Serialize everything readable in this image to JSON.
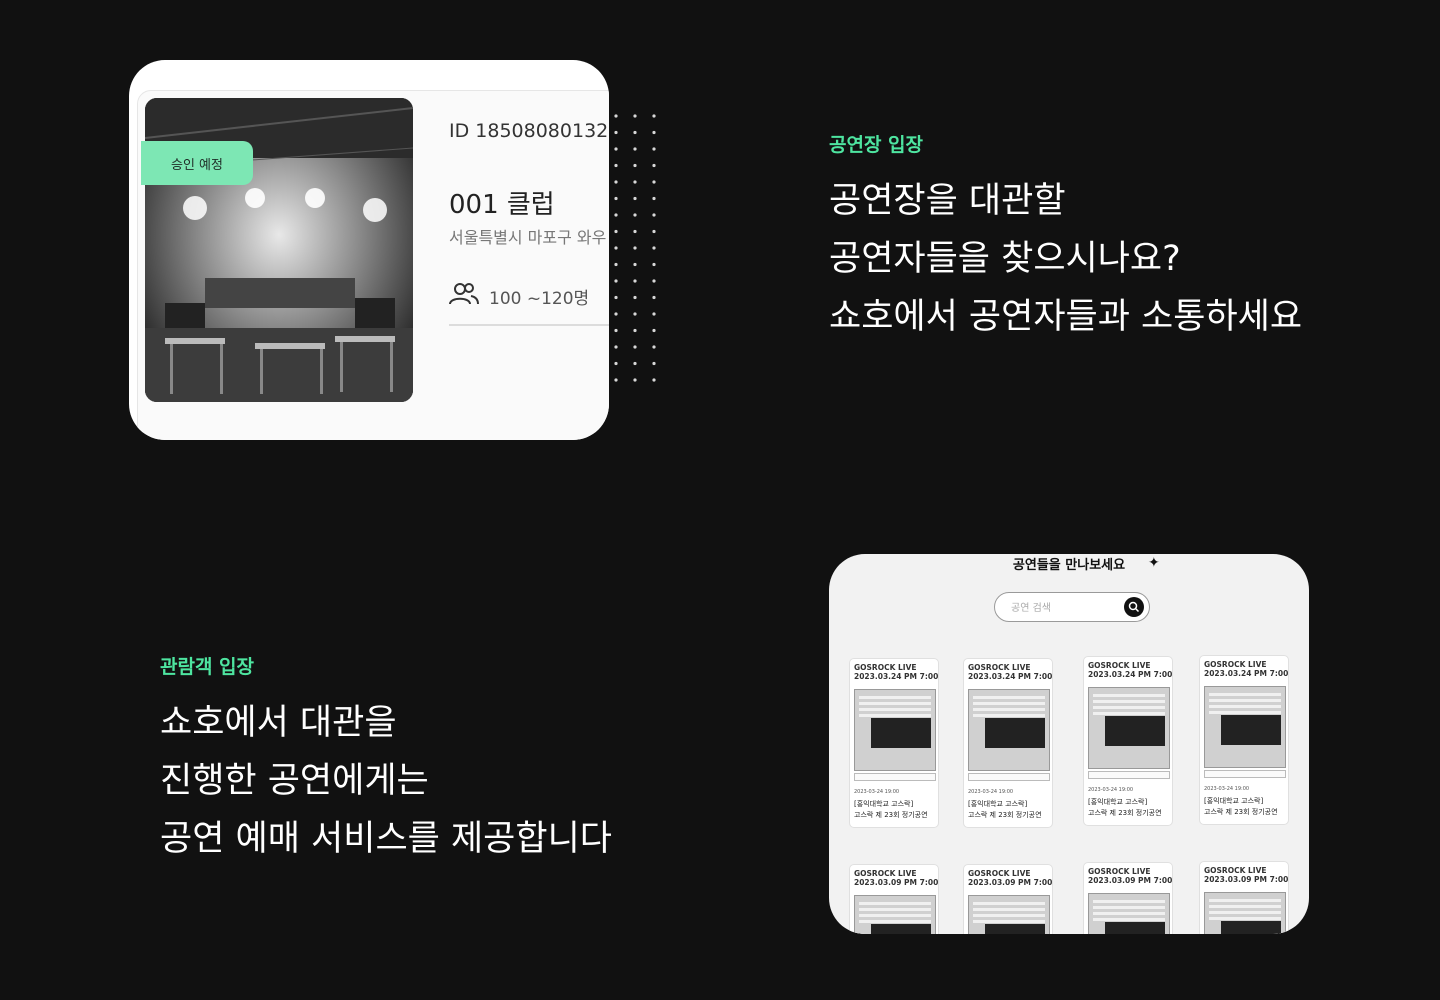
{
  "venue_card": {
    "badge": "승인 예정",
    "id_text": "ID 18508080132",
    "name": "001 클럽",
    "address": "서울특별시 마포구 와우",
    "capacity": "100 ~120명",
    "capacity_icon": "people-icon"
  },
  "host_section": {
    "eyebrow": "공연장 입장",
    "lines": [
      "공연장을 대관할",
      "공연자들을 찾으시나요?",
      "쇼호에서 공연자들과 소통하세요"
    ]
  },
  "audience_section": {
    "eyebrow": "관람객 입장",
    "lines": [
      "쇼호에서 대관을",
      "진행한 공연에게는",
      "공연 예매 서비스를 제공합니다"
    ]
  },
  "performance_screen": {
    "title": "공연들을 만나보세요",
    "title_icon": "sparkle-icon",
    "search_placeholder": "공연 검색",
    "search_icon": "search-icon",
    "row1_cards": [
      {
        "label": "GOSROCK LIVE",
        "datetime": "2023.03.24 PM 7:00",
        "date": "2023-03-24 19:00",
        "name1": "[홍익대학교 고스락]",
        "name2": "고스락 제 23회 정기공연"
      },
      {
        "label": "GOSROCK LIVE",
        "datetime": "2023.03.24 PM 7:00",
        "date": "2023-03-24 19:00",
        "name1": "[홍익대학교 고스락]",
        "name2": "고스락 제 23회 정기공연"
      },
      {
        "label": "GOSROCK LIVE",
        "datetime": "2023.03.24 PM 7:00",
        "date": "2023-03-24 19:00",
        "name1": "[홍익대학교 고스락]",
        "name2": "고스락 제 23회 정기공연"
      },
      {
        "label": "GOSROCK LIVE",
        "datetime": "2023.03.24 PM 7:00",
        "date": "2023-03-24 19:00",
        "name1": "[홍익대학교 고스락]",
        "name2": "고스락 제 23회 정기공연"
      }
    ],
    "row2_cards": [
      {
        "label": "GOSROCK LIVE",
        "datetime": "2023.03.09 PM 7:00"
      },
      {
        "label": "GOSROCK LIVE",
        "datetime": "2023.03.09 PM 7:00"
      },
      {
        "label": "GOSROCK LIVE",
        "datetime": "2023.03.09 PM 7:00"
      },
      {
        "label": "GOSROCK LIVE",
        "datetime": "2023.03.09 PM 7:00"
      }
    ]
  },
  "colors": {
    "background": "#111111",
    "accent": "#4ee5a0",
    "badge": "#7de7b4"
  }
}
